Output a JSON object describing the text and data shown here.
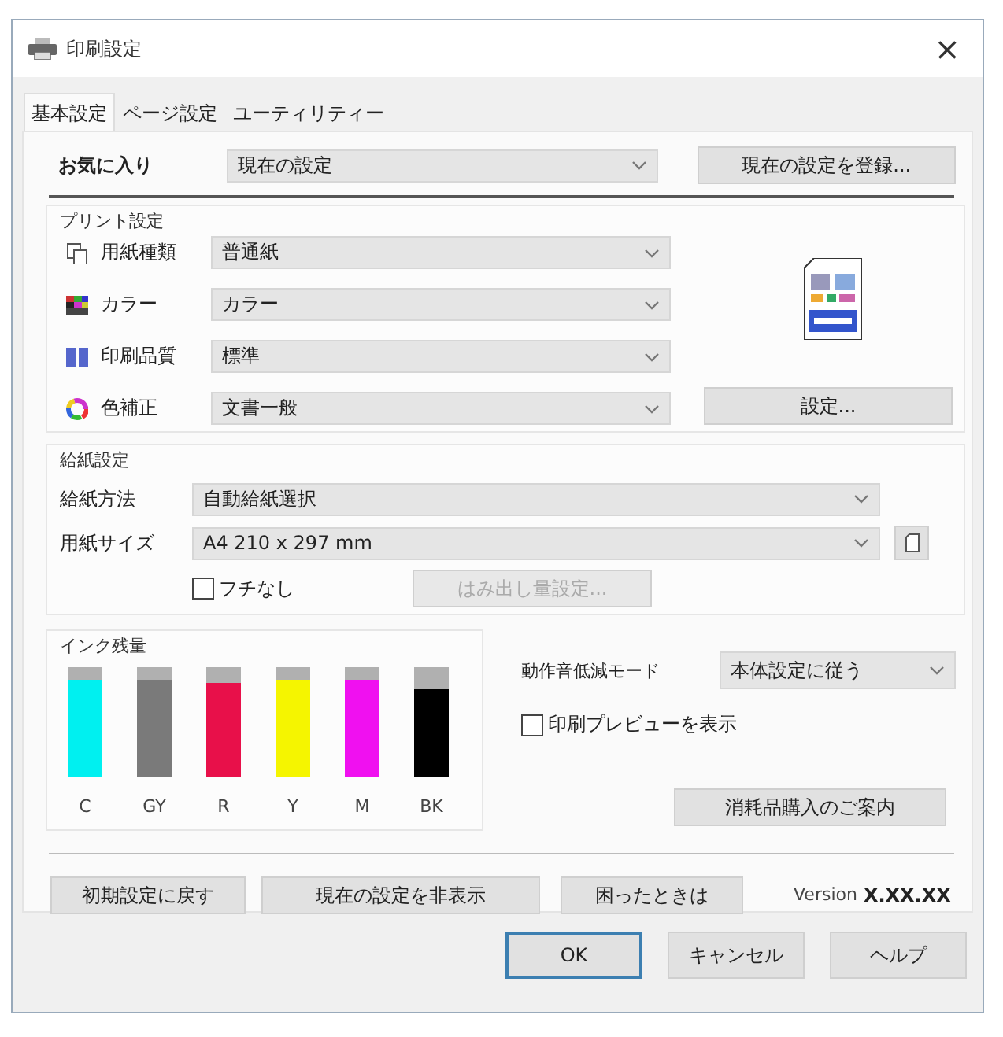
{
  "window": {
    "title": "印刷設定",
    "close": "×"
  },
  "tabs": [
    {
      "label": "基本設定",
      "selected": true
    },
    {
      "label": "ページ設定",
      "selected": false
    },
    {
      "label": "ユーティリティー",
      "selected": false
    }
  ],
  "favorites": {
    "label": "お気に入り",
    "value": "現在の設定",
    "button": "現在の設定を登録..."
  },
  "print_settings": {
    "title": "プリント設定",
    "rows": [
      {
        "label": "用紙種類",
        "value": "普通紙"
      },
      {
        "label": "カラー",
        "value": "カラー"
      },
      {
        "label": "印刷品質",
        "value": "標準"
      },
      {
        "label": "色補正",
        "value": "文書一般"
      }
    ],
    "button": "設定..."
  },
  "paper_source": {
    "title": "給紙設定",
    "rows": [
      {
        "label": "給紙方法",
        "value": "自動給紙選択"
      },
      {
        "label": "用紙サイズ",
        "value": "A4 210 x 297 mm"
      }
    ],
    "borderless": {
      "label": "フチなし",
      "checked": false
    },
    "expansion_button": {
      "label": "はみ出し量設定...",
      "disabled": true
    }
  },
  "ink_levels": {
    "title": "インク残量",
    "inks": [
      {
        "label": "C",
        "color": "#00f0f0",
        "level": 0.88
      },
      {
        "label": "GY",
        "color": "#7a7a7a",
        "level": 0.88
      },
      {
        "label": "R",
        "color": "#e8104a",
        "level": 0.86
      },
      {
        "label": "Y",
        "color": "#f5f500",
        "level": 0.88
      },
      {
        "label": "M",
        "color": "#f010f0",
        "level": 0.88
      },
      {
        "label": "BK",
        "color": "#000000",
        "level": 0.8
      }
    ]
  },
  "quiet_mode": {
    "label": "動作音低減モード",
    "value": "本体設定に従う"
  },
  "preview": {
    "label": "印刷プレビューを表示",
    "checked": false
  },
  "supplies_button": "消耗品購入のご案内",
  "footer_buttons": [
    "初期設定に戻す",
    "現在の設定を非表示",
    "困ったときは"
  ],
  "version": {
    "label": "Version",
    "value": "X.XX.XX"
  },
  "dialog_buttons": [
    {
      "label": "OK",
      "focused": true
    },
    {
      "label": "キャンセル",
      "focused": false
    },
    {
      "label": "ヘルプ",
      "focused": false
    }
  ]
}
